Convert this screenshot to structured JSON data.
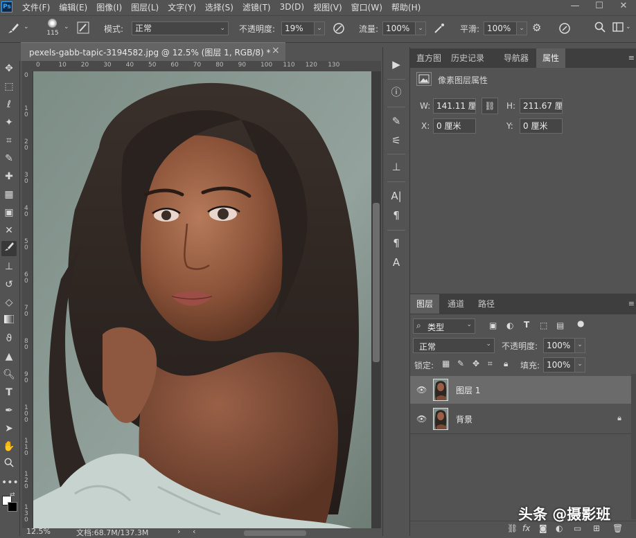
{
  "app": {
    "logo": "Ps"
  },
  "menu": [
    "文件(F)",
    "编辑(E)",
    "图像(I)",
    "图层(L)",
    "文字(Y)",
    "选择(S)",
    "滤镜(T)",
    "3D(D)",
    "视图(V)",
    "窗口(W)",
    "帮助(H)"
  ],
  "window_controls": {
    "minimize": "—",
    "maximize": "☐",
    "close": "✕"
  },
  "options": {
    "brush_size": "115",
    "mode_label": "模式:",
    "mode_value": "正常",
    "opacity_label": "不透明度:",
    "opacity_value": "19%",
    "flow_label": "流量:",
    "flow_value": "100%",
    "smooth_label": "平滑:",
    "smooth_value": "100%"
  },
  "document": {
    "tab_title": "pexels-gabb-tapic-3194582.jpg @ 12.5% (图层 1, RGB/8) *",
    "close": "×",
    "ruler_h": [
      "0",
      "10",
      "20",
      "30",
      "40",
      "50",
      "60",
      "70",
      "80",
      "90",
      "100",
      "110",
      "120",
      "130"
    ],
    "ruler_v": [
      "0",
      "1\n0",
      "2\n0",
      "3\n0",
      "4\n0",
      "5\n0",
      "6\n0",
      "7\n0",
      "8\n0",
      "9\n0",
      "1\n0\n0",
      "1\n1\n0",
      "1\n2\n0",
      "1\n3\n0"
    ],
    "zoom": "12.5%",
    "doc_info": "文档:68.7M/137.3M"
  },
  "panel_top": {
    "tabs": [
      "直方图",
      "历史记录",
      "导航器",
      "属性"
    ],
    "active_tab": "属性",
    "title": "像素图层属性",
    "w_label": "W:",
    "w_value": "141.11 厘",
    "h_label": "H:",
    "h_value": "211.67 厘",
    "x_label": "X:",
    "x_value": "0 厘米",
    "y_label": "Y:",
    "y_value": "0 厘米"
  },
  "layers_panel": {
    "tabs": [
      "图层",
      "通道",
      "路径"
    ],
    "active_tab": "图层",
    "filter_label": "类型",
    "blend_mode": "正常",
    "opacity_label": "不透明度:",
    "opacity_value": "100%",
    "lock_label": "锁定:",
    "fill_label": "填充:",
    "fill_value": "100%",
    "layers": [
      {
        "name": "图层 1",
        "selected": true,
        "locked": false
      },
      {
        "name": "背景",
        "selected": false,
        "locked": true
      }
    ]
  },
  "watermark": "头条 @摄影班",
  "colors": {
    "panel": "#535353",
    "dark": "#3e3e3e",
    "selected_layer": "#6b6b6b",
    "field": "#454545"
  }
}
